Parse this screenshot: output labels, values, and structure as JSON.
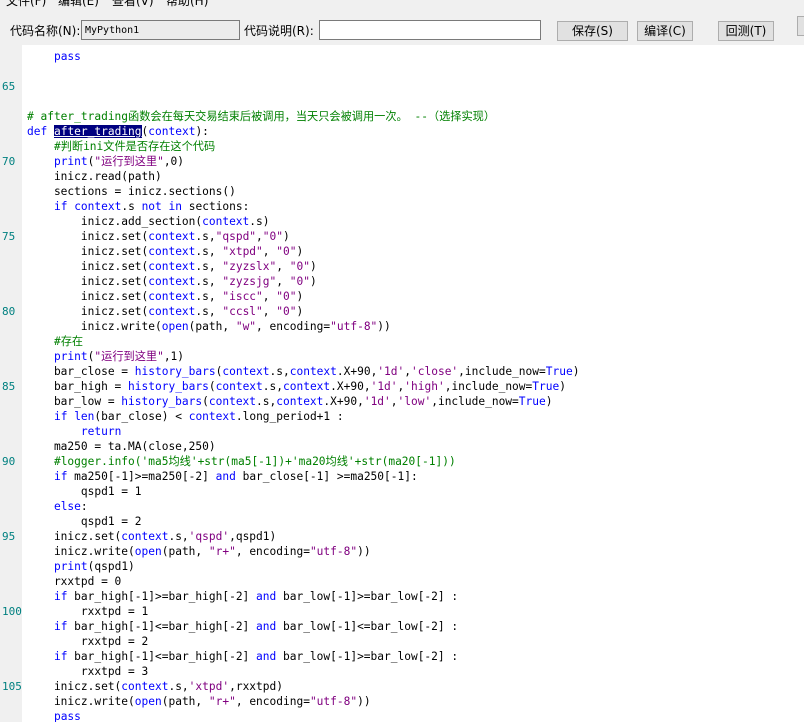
{
  "menu": {
    "items": [
      "文件(F)",
      "编辑(E)",
      "查看(V)",
      "帮助(H)"
    ]
  },
  "toolbar": {
    "name_label": "代码名称(N):",
    "name_value": "MyPython1",
    "desc_label": "代码说明(R):",
    "desc_value": "",
    "save_label": "保存(S)",
    "compile_label": "编译(C)",
    "backtest_label": "回测(T)"
  },
  "code_lines": [
    {
      "n": "",
      "h": "    <span class=\"k\">pass</span>"
    },
    {
      "n": "",
      "h": ""
    },
    {
      "n": "65",
      "h": ""
    },
    {
      "n": "",
      "h": ""
    },
    {
      "n": "",
      "h": "<span class=\"c\"># after_trading函数会在每天交易结束后被调用，当天只会被调用一次。 --（选择实现）</span>"
    },
    {
      "n": "",
      "h": "<span class=\"k\">def</span> <span class=\"hl\">after_trading</span>(<span class=\"k\">context</span>):"
    },
    {
      "n": "",
      "h": "    <span class=\"c\">#判断ini文件是否存在这个代码</span>"
    },
    {
      "n": "70",
      "h": "    <span class=\"k\">print</span>(<span class=\"s\">\"运行到这里\"</span>,0)"
    },
    {
      "n": "",
      "h": "    inicz.read(path)"
    },
    {
      "n": "",
      "h": "    sections = inicz.sections()"
    },
    {
      "n": "",
      "h": "    <span class=\"k\">if</span> <span class=\"k\">context</span>.s <span class=\"k\">not</span> <span class=\"k\">in</span> sections:"
    },
    {
      "n": "",
      "h": "        inicz.add_section(<span class=\"k\">context</span>.s)"
    },
    {
      "n": "75",
      "h": "        inicz.set(<span class=\"k\">context</span>.s,<span class=\"s\">\"qspd\"</span>,<span class=\"s\">\"0\"</span>)"
    },
    {
      "n": "",
      "h": "        inicz.set(<span class=\"k\">context</span>.s, <span class=\"s\">\"xtpd\"</span>, <span class=\"s\">\"0\"</span>)"
    },
    {
      "n": "",
      "h": "        inicz.set(<span class=\"k\">context</span>.s, <span class=\"s\">\"zyzslx\"</span>, <span class=\"s\">\"0\"</span>)"
    },
    {
      "n": "",
      "h": "        inicz.set(<span class=\"k\">context</span>.s, <span class=\"s\">\"zyzsjg\"</span>, <span class=\"s\">\"0\"</span>)"
    },
    {
      "n": "",
      "h": "        inicz.set(<span class=\"k\">context</span>.s, <span class=\"s\">\"iscc\"</span>, <span class=\"s\">\"0\"</span>)"
    },
    {
      "n": "80",
      "h": "        inicz.set(<span class=\"k\">context</span>.s, <span class=\"s\">\"ccsl\"</span>, <span class=\"s\">\"0\"</span>)"
    },
    {
      "n": "",
      "h": "        inicz.write(<span class=\"k\">open</span>(path, <span class=\"s\">\"w\"</span>, encoding=<span class=\"s\">\"utf-8\"</span>))"
    },
    {
      "n": "",
      "h": "    <span class=\"c\">#存在</span>"
    },
    {
      "n": "",
      "h": "    <span class=\"k\">print</span>(<span class=\"s\">\"运行到这里\"</span>,1)"
    },
    {
      "n": "",
      "h": "    bar_close = <span class=\"k\">history_bars</span>(<span class=\"k\">context</span>.s,<span class=\"k\">context</span>.X+90,<span class=\"s\">'1d'</span>,<span class=\"s\">'close'</span>,include_now=<span class=\"k\">True</span>)"
    },
    {
      "n": "85",
      "h": "    bar_high = <span class=\"k\">history_bars</span>(<span class=\"k\">context</span>.s,<span class=\"k\">context</span>.X+90,<span class=\"s\">'1d'</span>,<span class=\"s\">'high'</span>,include_now=<span class=\"k\">True</span>)"
    },
    {
      "n": "",
      "h": "    bar_low = <span class=\"k\">history_bars</span>(<span class=\"k\">context</span>.s,<span class=\"k\">context</span>.X+90,<span class=\"s\">'1d'</span>,<span class=\"s\">'low'</span>,include_now=<span class=\"k\">True</span>)"
    },
    {
      "n": "",
      "h": "    <span class=\"k\">if</span> <span class=\"k\">len</span>(bar_close) &lt; <span class=\"k\">context</span>.long_period+1 :"
    },
    {
      "n": "",
      "h": "        <span class=\"k\">return</span>"
    },
    {
      "n": "",
      "h": "    ma250 = ta.MA(close,250)"
    },
    {
      "n": "90",
      "h": "    <span class=\"c\">#logger.info('ma5均线'+str(ma5[-1])+'ma20均线'+str(ma20[-1]))</span>"
    },
    {
      "n": "",
      "h": "    <span class=\"k\">if</span> ma250[-1]&gt;=ma250[-2] <span class=\"k\">and</span> bar_close[-1] &gt;=ma250[-1]:"
    },
    {
      "n": "",
      "h": "        qspd1 = 1"
    },
    {
      "n": "",
      "h": "    <span class=\"k\">else</span>:"
    },
    {
      "n": "",
      "h": "        qspd1 = 2"
    },
    {
      "n": "95",
      "h": "    inicz.set(<span class=\"k\">context</span>.s,<span class=\"s\">'qspd'</span>,qspd1)"
    },
    {
      "n": "",
      "h": "    inicz.write(<span class=\"k\">open</span>(path, <span class=\"s\">\"r+\"</span>, encoding=<span class=\"s\">\"utf-8\"</span>))"
    },
    {
      "n": "",
      "h": "    <span class=\"k\">print</span>(qspd1)"
    },
    {
      "n": "",
      "h": "    rxxtpd = 0"
    },
    {
      "n": "",
      "h": "    <span class=\"k\">if</span> bar_high[-1]&gt;=bar_high[-2] <span class=\"k\">and</span> bar_low[-1]&gt;=bar_low[-2] :"
    },
    {
      "n": "100",
      "h": "        rxxtpd = 1"
    },
    {
      "n": "",
      "h": "    <span class=\"k\">if</span> bar_high[-1]&lt;=bar_high[-2] <span class=\"k\">and</span> bar_low[-1]&lt;=bar_low[-2] :"
    },
    {
      "n": "",
      "h": "        rxxtpd = 2"
    },
    {
      "n": "",
      "h": "    <span class=\"k\">if</span> bar_high[-1]&lt;=bar_high[-2] <span class=\"k\">and</span> bar_low[-1]&gt;=bar_low[-2] :"
    },
    {
      "n": "",
      "h": "        rxxtpd = 3"
    },
    {
      "n": "105",
      "h": "    inicz.set(<span class=\"k\">context</span>.s,<span class=\"s\">'xtpd'</span>,rxxtpd)"
    },
    {
      "n": "",
      "h": "    inicz.write(<span class=\"k\">open</span>(path, <span class=\"s\">\"r+\"</span>, encoding=<span class=\"s\">\"utf-8\"</span>))"
    },
    {
      "n": "",
      "h": "    <span class=\"k\">pass</span>"
    }
  ]
}
